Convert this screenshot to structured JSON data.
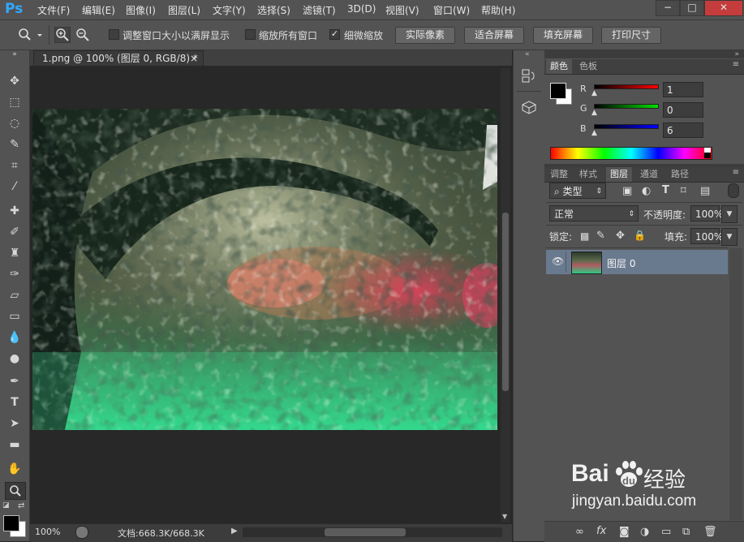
{
  "menubar": {
    "logo": "Ps",
    "items": [
      "文件(F)",
      "编辑(E)",
      "图像(I)",
      "图层(L)",
      "文字(Y)",
      "选择(S)",
      "滤镜(T)",
      "3D(D)",
      "视图(V)",
      "窗口(W)",
      "帮助(H)"
    ],
    "window_buttons": [
      "−",
      "□",
      "✕"
    ]
  },
  "options": {
    "checkbox1": "调整窗口大小以满屏显示",
    "checkbox2": "缩放所有窗口",
    "checkbox3": "细微缩放",
    "btn_actual": "实际像素",
    "btn_fit": "适合屏幕",
    "btn_fill": "填充屏幕",
    "btn_print": "打印尺寸"
  },
  "document": {
    "tab_title": "1.png @ 100% (图层 0, RGB/8) *",
    "tab_close": "×"
  },
  "status": {
    "zoom": "100%",
    "doc_info": "文档:668.3K/668.3K",
    "arrow": "▶"
  },
  "color_panel": {
    "tab_color": "颜色",
    "tab_swatches": "色板",
    "r_label": "R",
    "g_label": "G",
    "b_label": "B",
    "r_value": "1",
    "g_value": "0",
    "b_value": "6",
    "accent_red": "#e02020",
    "accent_green": "#20c020",
    "accent_blue": "#2020e0"
  },
  "layers_panel": {
    "tabs": [
      "调整",
      "样式",
      "图层",
      "通道",
      "路径"
    ],
    "filter_kind": "类型",
    "blend_mode": "正常",
    "opacity_label": "不透明度:",
    "opacity_value": "100%",
    "lock_label": "锁定:",
    "fill_label": "填充:",
    "fill_value": "100%",
    "layer_name": "图层 0"
  },
  "watermark": {
    "brand": "Bai",
    "brand2": "du",
    "brand_cn": "经验",
    "url": "jingyan.baidu.com"
  }
}
